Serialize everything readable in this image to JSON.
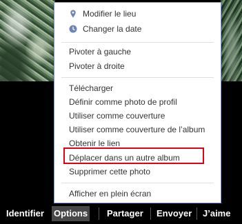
{
  "menu": {
    "groups": [
      [
        {
          "label": "Modifier le lieu",
          "icon": "location-pin-icon"
        },
        {
          "label": "Changer la date",
          "icon": "clock-icon"
        }
      ],
      [
        {
          "label": "Pivoter à gauche"
        },
        {
          "label": "Pivoter à droite"
        }
      ],
      [
        {
          "label": "Télécharger"
        },
        {
          "label": "Définir comme photo de profil"
        },
        {
          "label": "Utiliser comme couverture"
        },
        {
          "label": "Utiliser comme couverture de l’album"
        },
        {
          "label": "Obtenir le lien"
        },
        {
          "label": "Déplacer dans un autre album"
        },
        {
          "label": "Supprimer cette photo"
        }
      ],
      [
        {
          "label": "Afficher en plein écran"
        }
      ]
    ]
  },
  "toolbar": {
    "identify": "Identifier",
    "options": "Options",
    "share": "Partager",
    "send": "Envoyer",
    "like": "J’aime"
  },
  "colors": {
    "highlight": "#e0000f",
    "icon": "#6d84b4"
  }
}
